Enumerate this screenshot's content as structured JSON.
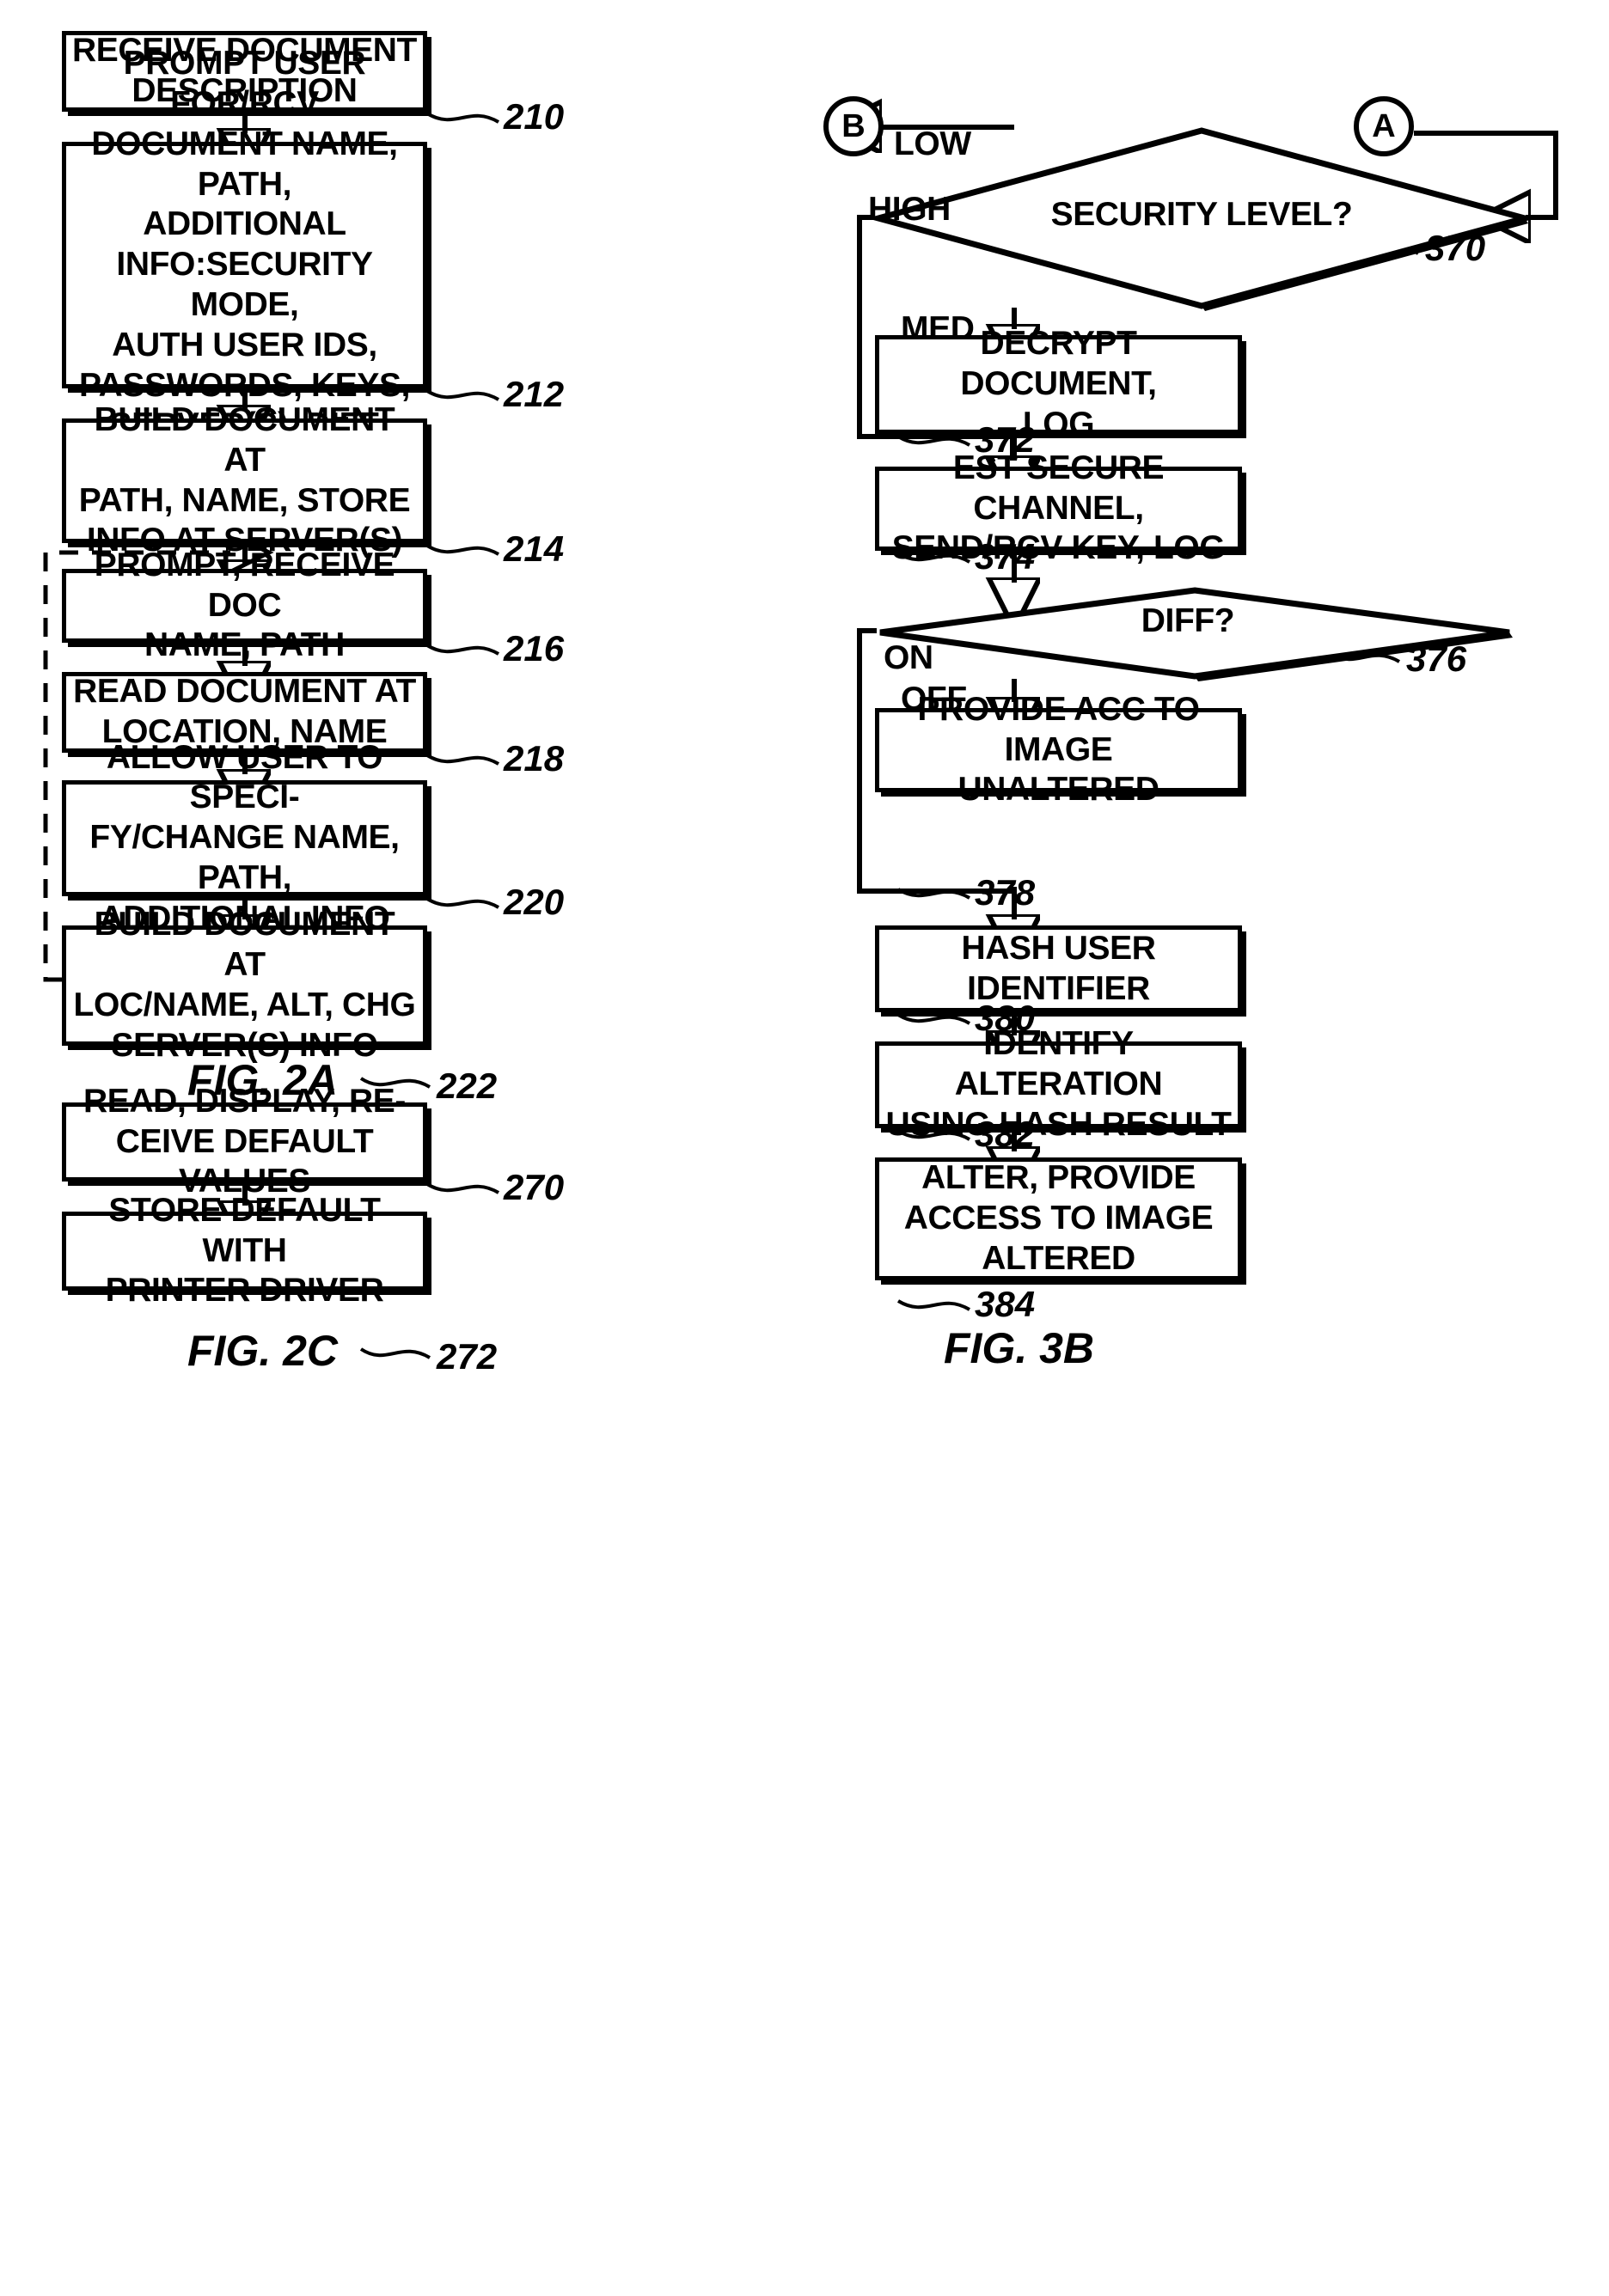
{
  "figures": [
    {
      "id": "fig-2a",
      "caption": "FIG. 2A",
      "steps": [
        {
          "ref": "210",
          "text": "RECEIVE DOCUMENT\nDESCRIPTION"
        },
        {
          "ref": "212",
          "text": "PROMPT USER FOR/RCV\nDOCUMENT NAME, PATH,\nADDITIONAL\nINFO:SECURITY MODE,\nAUTH USER IDS,\nPASSWORDS, KEYS,\nSERVER(S), DIFF ON/OFF"
        },
        {
          "ref": "214",
          "text": "BUILD DOCUMENT AT\nPATH, NAME, STORE\nINFO AT SERVER(S)"
        },
        {
          "ref": "216",
          "text": "PROMPT, RECEIVE DOC\nNAME, PATH"
        },
        {
          "ref": "218",
          "text": "READ DOCUMENT AT\nLOCATION, NAME"
        },
        {
          "ref": "220",
          "text": "ALLOW USER TO SPECI-\nFY/CHANGE NAME, PATH,\nADDITIONAL INFO"
        },
        {
          "ref": "222",
          "text": "BUILD DOCUMENT AT\nLOC/NAME, ALT, CHG\nSERVER(S) INFO"
        }
      ]
    },
    {
      "id": "fig-2c",
      "caption": "FIG. 2C",
      "steps": [
        {
          "ref": "270",
          "text": "READ, DISPLAY, RE-\nCEIVE DEFAULT VALUES"
        },
        {
          "ref": "272",
          "text": "STORE DEFAULT WITH\nPRINTER DRIVER"
        }
      ]
    },
    {
      "id": "fig-3b",
      "caption": "FIG. 3B",
      "connectors": [
        {
          "id": "conn-b",
          "label": "B"
        },
        {
          "id": "conn-a",
          "label": "A"
        }
      ],
      "decisions": [
        {
          "ref": "370",
          "text": "SECURITY LEVEL?",
          "branches": [
            "LOW",
            "HIGH",
            "MED"
          ]
        },
        {
          "ref": "376",
          "text": "DIFF?",
          "branches": [
            "ON",
            "OFF"
          ]
        }
      ],
      "steps": [
        {
          "ref": "372",
          "text": "DECRYPT DOCUMENT,\nLOG"
        },
        {
          "ref": "374",
          "text": "EST SECURE CHANNEL,\nSEND/RCV KEY, LOG"
        },
        {
          "ref": "378",
          "text": "PROVIDE ACC TO IMAGE\nUNALTERED"
        },
        {
          "ref": "380",
          "text": "HASH USER IDENTIFIER"
        },
        {
          "ref": "382",
          "text": "IDENTIFY ALTERATION\nUSING HASH RESULT"
        },
        {
          "ref": "384",
          "text": "ALTER, PROVIDE\nACCESS TO IMAGE\nALTERED"
        }
      ]
    }
  ],
  "branch_labels": {
    "low": "LOW",
    "high": "HIGH",
    "med": "MED",
    "on": "ON",
    "off": "OFF"
  },
  "connectors": {
    "b": "B",
    "a": "A"
  },
  "colors": {
    "ink": "#000000",
    "paper": "#ffffff"
  }
}
